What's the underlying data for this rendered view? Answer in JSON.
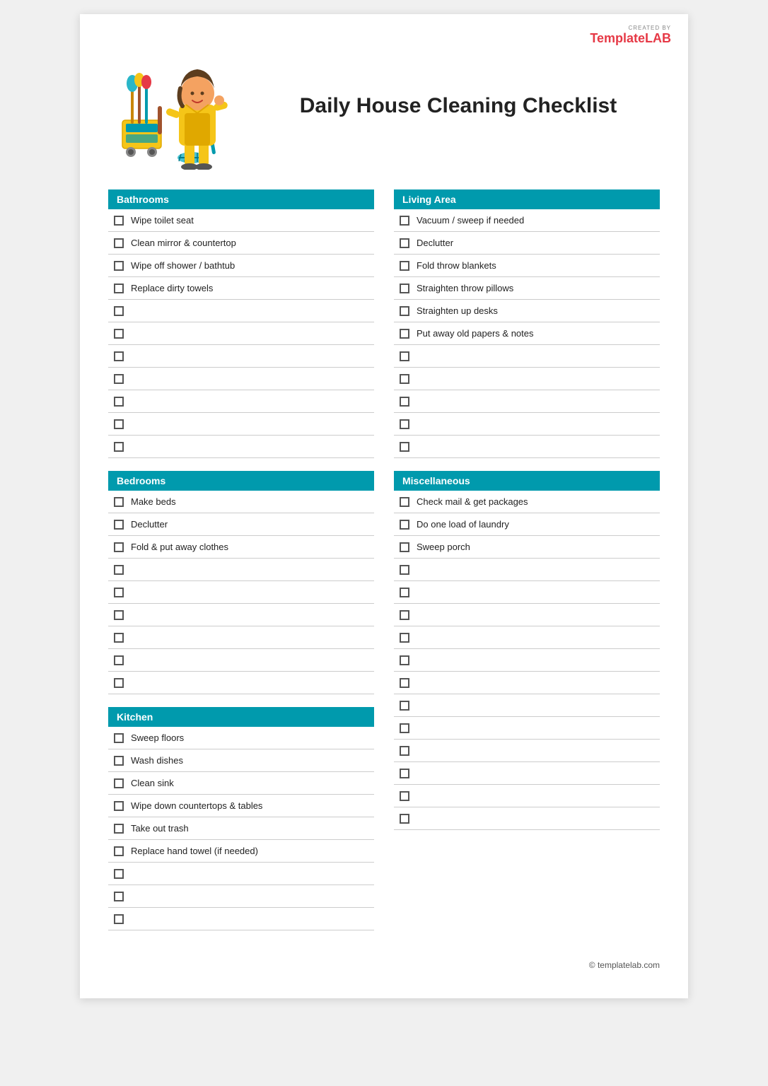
{
  "logo": {
    "created_by": "CREATED BY",
    "brand_template": "Template",
    "brand_lab": "LAB"
  },
  "title": "Daily House Cleaning Checklist",
  "sections": {
    "left": [
      {
        "header": "Bathrooms",
        "items": [
          "Wipe toilet seat",
          "Clean mirror & countertop",
          "Wipe off shower / bathtub",
          "Replace dirty towels",
          "",
          "",
          "",
          "",
          "",
          "",
          ""
        ]
      },
      {
        "header": "Bedrooms",
        "items": [
          "Make beds",
          "Declutter",
          "Fold & put away clothes",
          "",
          "",
          "",
          "",
          "",
          ""
        ]
      },
      {
        "header": "Kitchen",
        "items": [
          "Sweep floors",
          "Wash dishes",
          "Clean sink",
          "Wipe down countertops & tables",
          "Take out trash",
          "Replace hand towel (if needed)",
          "",
          "",
          ""
        ]
      }
    ],
    "right": [
      {
        "header": "Living Area",
        "items": [
          "Vacuum / sweep if needed",
          "Declutter",
          "Fold throw blankets",
          "Straighten throw pillows",
          "Straighten up desks",
          "Put away old papers & notes",
          "",
          "",
          "",
          "",
          ""
        ]
      },
      {
        "header": "Miscellaneous",
        "items": [
          "Check mail & get packages",
          "Do one load of laundry",
          "Sweep porch",
          "",
          "",
          "",
          "",
          "",
          "",
          "",
          "",
          "",
          "",
          "",
          ""
        ]
      }
    ]
  },
  "footer": "© templatelab.com"
}
